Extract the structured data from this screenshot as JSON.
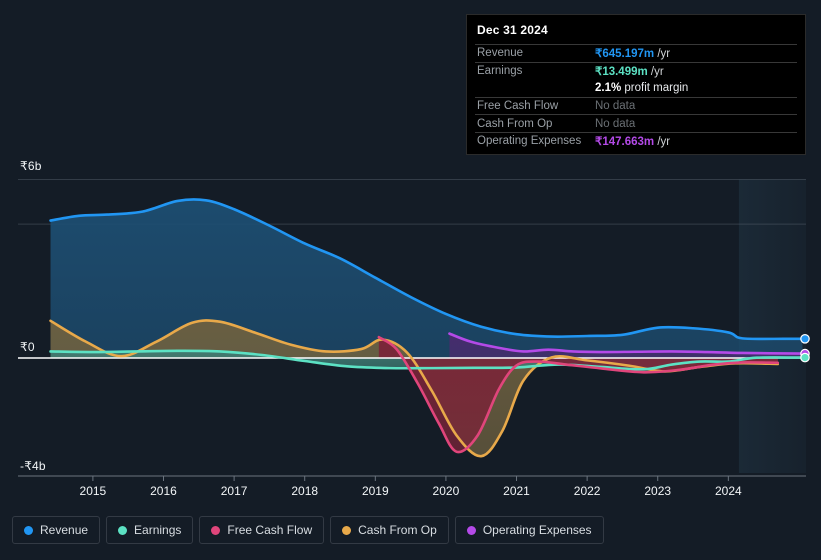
{
  "chart_data": {
    "type": "area",
    "title": "",
    "xlabel": "",
    "ylabel": "",
    "currency_symbol": "₹",
    "xlim": [
      2014.35,
      2025.1
    ],
    "ylim": [
      -4.0,
      6.0
    ],
    "y_ticks": [
      {
        "value": 6,
        "label": "₹6b"
      },
      {
        "value": 0,
        "label": "₹0"
      },
      {
        "value": -4,
        "label": "-₹4b"
      }
    ],
    "x_ticks": [
      {
        "value": 2015,
        "label": "2015"
      },
      {
        "value": 2016,
        "label": "2016"
      },
      {
        "value": 2017,
        "label": "2017"
      },
      {
        "value": 2018,
        "label": "2018"
      },
      {
        "value": 2019,
        "label": "2019"
      },
      {
        "value": 2020,
        "label": "2020"
      },
      {
        "value": 2021,
        "label": "2021"
      },
      {
        "value": 2022,
        "label": "2022"
      },
      {
        "value": 2023,
        "label": "2023"
      },
      {
        "value": 2024,
        "label": "2024"
      }
    ],
    "grid": {
      "horizontal": true,
      "vertical": false,
      "gridlines_y": [
        6,
        4.5
      ]
    },
    "highlight_band": {
      "from": 2024.15,
      "to": 2025.1,
      "label": "latest-period"
    },
    "units": "billions of ₹ per year",
    "series": [
      {
        "name": "Revenue",
        "color": "#2196f3",
        "fill": "#1d4e72",
        "x": [
          2014.4,
          2014.8,
          2015.2,
          2015.7,
          2016.2,
          2016.6,
          2017.0,
          2017.5,
          2018.0,
          2018.5,
          2019.0,
          2019.5,
          2020.0,
          2020.5,
          2021.0,
          2021.5,
          2022.0,
          2022.5,
          2023.0,
          2023.5,
          2024.0,
          2024.2,
          2024.8,
          2025.05
        ],
        "values": [
          4.62,
          4.78,
          4.82,
          4.92,
          5.28,
          5.3,
          5.0,
          4.45,
          3.85,
          3.35,
          2.7,
          2.05,
          1.48,
          1.05,
          0.8,
          0.72,
          0.74,
          0.78,
          1.02,
          1.0,
          0.86,
          0.66,
          0.645,
          0.645
        ]
      },
      {
        "name": "Earnings",
        "color": "#5ce1c3",
        "fill": "#3e7a72",
        "x": [
          2014.4,
          2015.0,
          2015.6,
          2016.2,
          2016.8,
          2017.4,
          2018.0,
          2018.6,
          2019.2,
          2019.8,
          2020.4,
          2021.0,
          2021.6,
          2022.2,
          2022.8,
          2023.2,
          2023.6,
          2024.0,
          2024.4,
          2025.05
        ],
        "values": [
          0.22,
          0.2,
          0.22,
          0.24,
          0.22,
          0.1,
          -0.1,
          -0.28,
          -0.34,
          -0.34,
          -0.33,
          -0.32,
          -0.22,
          -0.3,
          -0.38,
          -0.22,
          -0.12,
          -0.12,
          0.01,
          0.0135
        ]
      },
      {
        "name": "Free Cash Flow",
        "color": "#e0457b",
        "fill": "#7a2438",
        "x": [
          2019.05,
          2019.3,
          2019.6,
          2019.9,
          2020.15,
          2020.45,
          2020.75,
          2021.0,
          2021.3,
          2021.7,
          2022.2,
          2022.8,
          2023.3,
          2023.8,
          2024.2,
          2024.7
        ],
        "values": [
          0.7,
          0.3,
          -0.85,
          -2.2,
          -3.15,
          -2.6,
          -1.05,
          -0.25,
          -0.12,
          -0.22,
          -0.35,
          -0.48,
          -0.4,
          -0.22,
          -0.15,
          -0.16
        ]
      },
      {
        "name": "Cash From Op",
        "color": "#e8a94a",
        "fill": "#6d6040",
        "x": [
          2014.4,
          2014.9,
          2015.4,
          2015.9,
          2016.4,
          2016.8,
          2017.3,
          2017.8,
          2018.3,
          2018.8,
          2019.1,
          2019.45,
          2019.8,
          2020.15,
          2020.5,
          2020.8,
          2021.1,
          2021.5,
          2022.0,
          2022.6,
          2023.1,
          2023.6,
          2024.1,
          2024.7
        ],
        "values": [
          1.25,
          0.55,
          0.06,
          0.55,
          1.18,
          1.22,
          0.85,
          0.45,
          0.22,
          0.3,
          0.62,
          0.18,
          -1.1,
          -2.6,
          -3.3,
          -2.45,
          -0.75,
          0.02,
          -0.08,
          -0.26,
          -0.45,
          -0.3,
          -0.18,
          -0.2
        ]
      },
      {
        "name": "Operating Expenses",
        "color": "#b44ae8",
        "fill": "#4a2a6e",
        "x": [
          2020.05,
          2020.35,
          2020.75,
          2021.1,
          2021.45,
          2021.8,
          2022.2,
          2022.7,
          2023.2,
          2023.7,
          2024.2,
          2025.05
        ],
        "values": [
          0.82,
          0.55,
          0.34,
          0.22,
          0.28,
          0.22,
          0.2,
          0.21,
          0.22,
          0.2,
          0.17,
          0.1477
        ]
      }
    ]
  },
  "tooltip": {
    "date": "Dec 31 2024",
    "rows": [
      {
        "key": "Revenue",
        "value": "₹645.197m",
        "unit": "/yr",
        "color": "#2196f3",
        "type": "value"
      },
      {
        "key": "Earnings",
        "value": "₹13.499m",
        "unit": "/yr",
        "color": "#5ce1c3",
        "type": "value"
      },
      {
        "key": "",
        "value": "2.1%",
        "unit": "profit margin",
        "color": "#ffffff",
        "type": "margin"
      },
      {
        "key": "Free Cash Flow",
        "value": "No data",
        "unit": "",
        "color": "#6b7075",
        "type": "nodata"
      },
      {
        "key": "Cash From Op",
        "value": "No data",
        "unit": "",
        "color": "#6b7075",
        "type": "nodata"
      },
      {
        "key": "Operating Expenses",
        "value": "₹147.663m",
        "unit": "/yr",
        "color": "#b44ae8",
        "type": "value"
      }
    ]
  },
  "legend": {
    "items": [
      {
        "label": "Revenue",
        "color": "#2196f3"
      },
      {
        "label": "Earnings",
        "color": "#5ce1c3"
      },
      {
        "label": "Free Cash Flow",
        "color": "#e0457b"
      },
      {
        "label": "Cash From Op",
        "color": "#e8a94a"
      },
      {
        "label": "Operating Expenses",
        "color": "#b44ae8"
      }
    ]
  },
  "colors": {
    "background": "#141c26",
    "tooltip_background": "#000000",
    "zero_line": "#ffffff",
    "gridline": "#5a6470",
    "axis_text": "#f2f5f7"
  }
}
